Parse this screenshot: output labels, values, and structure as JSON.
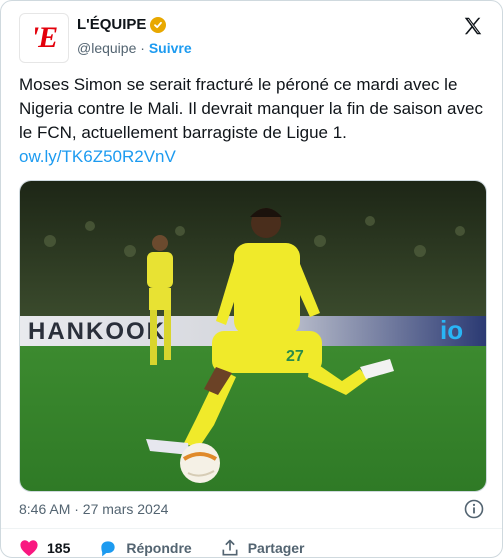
{
  "header": {
    "display_name": "L'ÉQUIPE",
    "handle": "@lequipe",
    "separator": "·",
    "follow_label": "Suivre",
    "avatar_letter": "'E",
    "verified_color": "#e8a800"
  },
  "tweet": {
    "text": "Moses Simon se serait fracturé le péroné ce mardi avec le Nigeria contre le Mali. Il devrait manquer la fin de saison avec le FCN, actuellement barragiste de Ligue 1. ",
    "link": "ow.ly/TK6Z50R2VnV"
  },
  "media": {
    "board_text_left": "HANKOOK",
    "board_text_right": "io",
    "player_number": "27"
  },
  "meta": {
    "timestamp": "8:46 AM · 27 mars 2024"
  },
  "actions": {
    "likes": "185",
    "reply_label": "Répondre",
    "share_label": "Partager"
  },
  "colors": {
    "accent": "#1d9bf0",
    "like": "#f91880",
    "brand": "#e3000b"
  }
}
